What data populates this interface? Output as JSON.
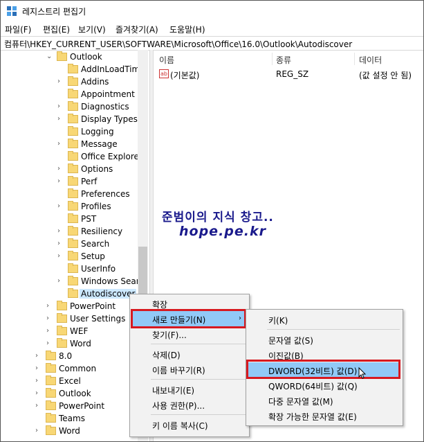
{
  "window": {
    "title": "레지스트리 편집기"
  },
  "menu": [
    "파일(F)",
    "편집(E)",
    "보기(V)",
    "즐겨찾기(A)",
    "도움말(H)"
  ],
  "address": "컴퓨터\\HKEY_CURRENT_USER\\SOFTWARE\\Microsoft\\Office\\16.0\\Outlook\\Autodiscover",
  "tree": [
    {
      "label": "Outlook",
      "expanded": true
    },
    {
      "label": "AddInLoadTimes"
    },
    {
      "label": "Addins"
    },
    {
      "label": "Appointment"
    },
    {
      "label": "Diagnostics"
    },
    {
      "label": "Display Types"
    },
    {
      "label": "Logging"
    },
    {
      "label": "Message"
    },
    {
      "label": "Office Explorer"
    },
    {
      "label": "Options"
    },
    {
      "label": "Perf"
    },
    {
      "label": "Preferences"
    },
    {
      "label": "Profiles"
    },
    {
      "label": "PST"
    },
    {
      "label": "Resiliency"
    },
    {
      "label": "Search"
    },
    {
      "label": "Setup"
    },
    {
      "label": "UserInfo"
    },
    {
      "label": "Windows Search"
    },
    {
      "label": "Autodiscover",
      "selected": true
    },
    {
      "label": "PowerPoint"
    },
    {
      "label": "User Settings"
    },
    {
      "label": "WEF"
    },
    {
      "label": "Word"
    },
    {
      "label": "8.0"
    },
    {
      "label": "Common"
    },
    {
      "label": "Excel"
    },
    {
      "label": "Outlook"
    },
    {
      "label": "PowerPoint"
    },
    {
      "label": "Teams"
    },
    {
      "label": "Word"
    }
  ],
  "columns": {
    "name": "이름",
    "type": "종류",
    "data": "데이터"
  },
  "values": [
    {
      "name": "(기본값)",
      "type": "REG_SZ",
      "data": "(값 설정 안 됨)"
    }
  ],
  "watermark": {
    "line1": "준범이의 지식 창고..",
    "line2": "hope.pe.kr"
  },
  "context_menu": {
    "expand": "확장",
    "new": "새로 만들기(N)",
    "find": "찾기(F)...",
    "delete": "삭제(D)",
    "rename": "이름 바꾸기(R)",
    "export": "내보내기(E)",
    "permissions": "사용 권한(P)...",
    "copy_key_name": "키 이름 복사(C)"
  },
  "submenu": {
    "key": "키(K)",
    "string": "문자열 값(S)",
    "binary": "이진값(B)",
    "dword": "DWORD(32비트) 값(D)",
    "qword": "QWORD(64비트) 값(Q)",
    "multi_string": "다중 문자열 값(M)",
    "expandable_string": "확장 가능한 문자열 값(E)"
  }
}
